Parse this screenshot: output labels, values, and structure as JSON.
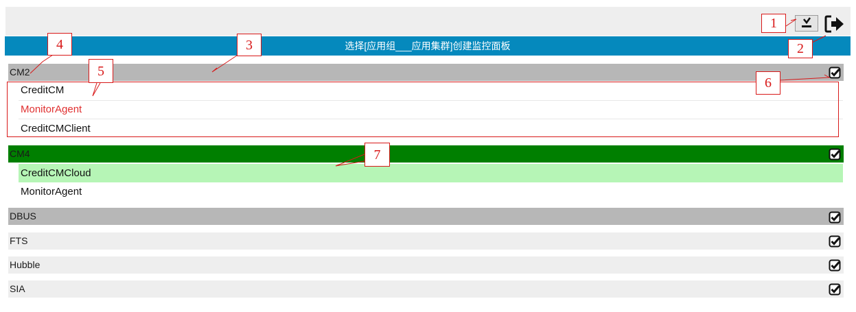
{
  "toolbar": {
    "export_icon": "download-icon",
    "logout_icon": "logout-arrow-icon"
  },
  "title": "选择[应用组___应用集群]创建监控面板",
  "groups": [
    {
      "name": "CM2",
      "items": [
        "CreditCM",
        "MonitorAgent",
        "CreditCMClient"
      ]
    },
    {
      "name": "CM4",
      "items": [
        "CreditCMCloud",
        "MonitorAgent"
      ]
    },
    {
      "name": "DBUS",
      "items": []
    },
    {
      "name": "FTS",
      "items": []
    },
    {
      "name": "Hubble",
      "items": []
    },
    {
      "name": "SIA",
      "items": []
    }
  ],
  "annotations": [
    "1",
    "2",
    "3",
    "4",
    "5",
    "6",
    "7"
  ],
  "colors": {
    "title_bg": "#0589bd",
    "group_selected": "#007f00",
    "group_active": "#b7b7b7",
    "group_default": "#eeeeee",
    "item_highlight": "#b6f5b6",
    "item_red": "#e03030",
    "annotation": "#d81818"
  }
}
